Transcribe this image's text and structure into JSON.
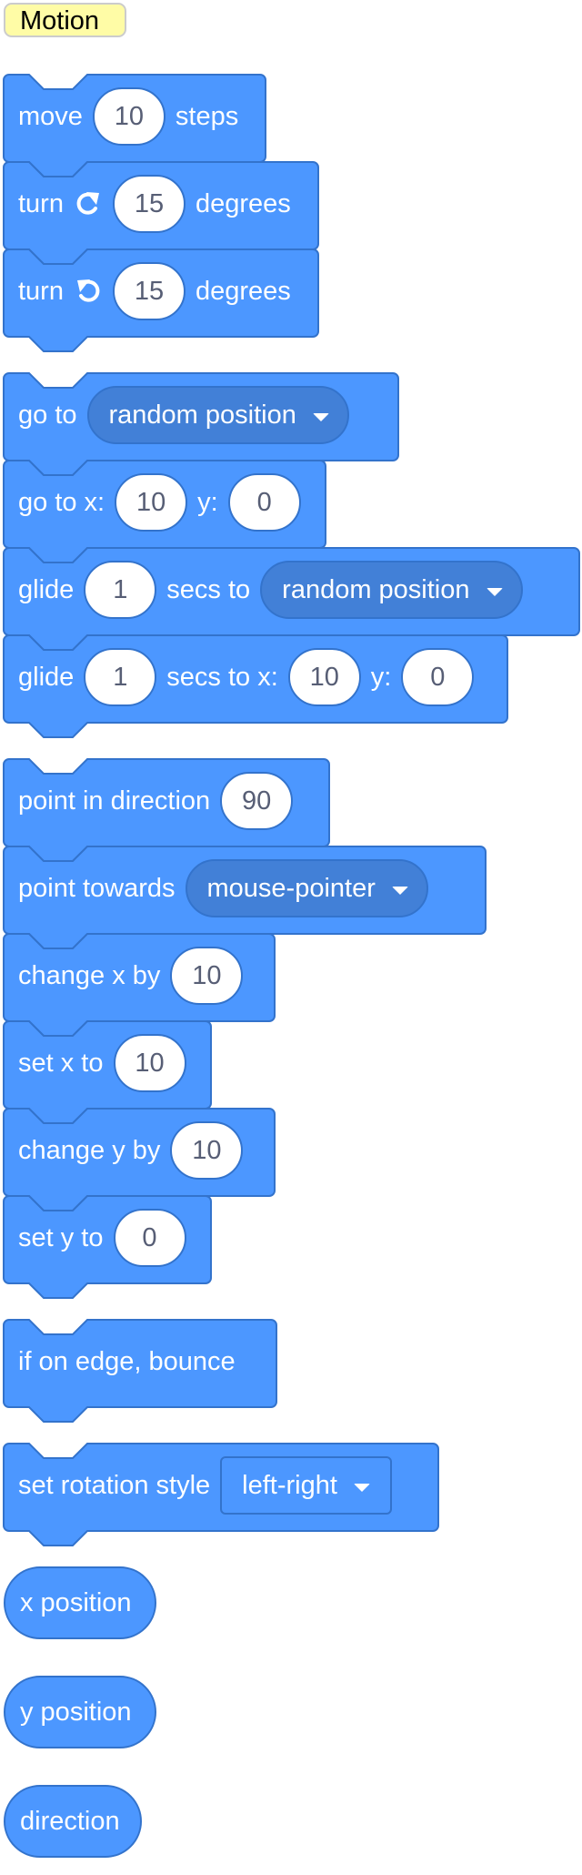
{
  "category": {
    "label": "Motion"
  },
  "colors": {
    "block_fill": "#4c97ff",
    "block_stroke": "#3373cc",
    "menu_fill": "#4280d7",
    "input_fill": "#ffffff",
    "input_text": "#575e75",
    "category_fill": "#fffca6"
  },
  "blocks": {
    "move": {
      "t1": "move",
      "value": "10",
      "t2": "steps"
    },
    "turn_right": {
      "t1": "turn",
      "icon": "rotate-right-icon",
      "value": "15",
      "t2": "degrees"
    },
    "turn_left": {
      "t1": "turn",
      "icon": "rotate-left-icon",
      "value": "15",
      "t2": "degrees"
    },
    "go_to": {
      "t1": "go to",
      "menu": "random position"
    },
    "go_to_xy": {
      "t1": "go to x:",
      "x": "10",
      "t2": "y:",
      "y": "0"
    },
    "glide_to": {
      "t1": "glide",
      "secs": "1",
      "t2": "secs to",
      "menu": "random position"
    },
    "glide_xy": {
      "t1": "glide",
      "secs": "1",
      "t2": "secs to x:",
      "x": "10",
      "t3": "y:",
      "y": "0"
    },
    "point_dir": {
      "t1": "point in direction",
      "value": "90"
    },
    "point_towards": {
      "t1": "point towards",
      "menu": "mouse-pointer"
    },
    "change_x": {
      "t1": "change x by",
      "value": "10"
    },
    "set_x": {
      "t1": "set x to",
      "value": "10"
    },
    "change_y": {
      "t1": "change y by",
      "value": "10"
    },
    "set_y": {
      "t1": "set y to",
      "value": "0"
    },
    "bounce": {
      "t1": "if on edge, bounce"
    },
    "rotation_style": {
      "t1": "set rotation style",
      "menu": "left-right"
    }
  },
  "reporters": {
    "x_position": "x position",
    "y_position": "y position",
    "direction": "direction"
  }
}
